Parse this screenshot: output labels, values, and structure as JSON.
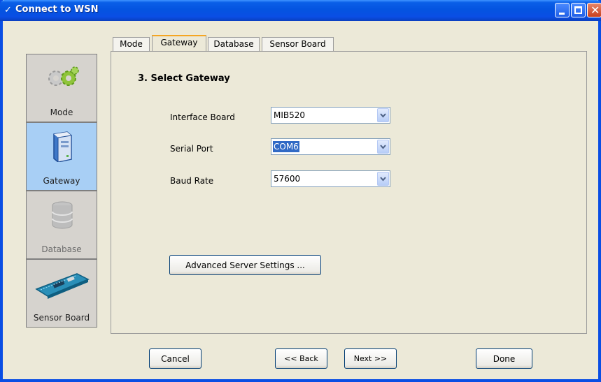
{
  "window": {
    "title": "Connect to WSN"
  },
  "nav": {
    "items": [
      {
        "label": "Mode",
        "icon": "gears-icon",
        "state": "normal"
      },
      {
        "label": "Gateway",
        "icon": "computer-tower-icon",
        "state": "active"
      },
      {
        "label": "Database",
        "icon": "database-icon",
        "state": "disabled"
      },
      {
        "label": "Sensor Board",
        "icon": "circuit-board-icon",
        "state": "normal"
      }
    ]
  },
  "tabs": [
    {
      "label": "Mode"
    },
    {
      "label": "Gateway",
      "active": true
    },
    {
      "label": "Database"
    },
    {
      "label": "Sensor Board"
    }
  ],
  "panel": {
    "section_title": "3. Select Gateway",
    "fields": [
      {
        "label": "Interface Board",
        "value": "MIB520"
      },
      {
        "label": "Serial Port",
        "value": "COM6"
      },
      {
        "label": "Baud Rate",
        "value": "57600"
      }
    ],
    "advanced_button": "Advanced Server Settings ..."
  },
  "footer": {
    "cancel": "Cancel",
    "back": "<< Back",
    "next": "Next >>",
    "done": "Done"
  },
  "colors": {
    "titlebar": "#0a4ee4",
    "active_nav": "#a8cff5",
    "active_tab_accent": "#f5a623",
    "selection": "#316ac5"
  }
}
